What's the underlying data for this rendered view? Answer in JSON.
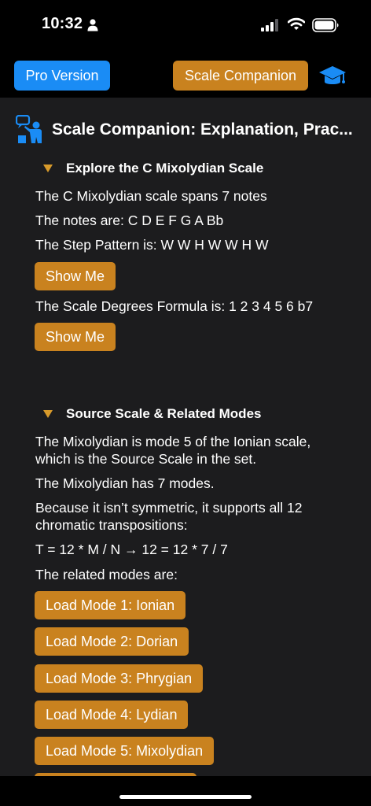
{
  "status": {
    "time": "10:32"
  },
  "toolbar": {
    "pro_label": "Pro Version",
    "companion_label": "Scale Companion"
  },
  "header": {
    "title": "Scale Companion: Explanation, Prac..."
  },
  "explore": {
    "title": "Explore the C Mixolydian Scale",
    "spans": "The C Mixolydian scale spans 7 notes",
    "notes": "The notes are:  C D E F G A Bb",
    "steps": "The Step Pattern is: W W H W W H W",
    "show_me_1": "Show Me",
    "degrees": "The Scale Degrees Formula is: 1 2 3 4 5 6 b7",
    "show_me_2": "Show Me"
  },
  "source": {
    "title": "Source Scale & Related Modes",
    "line1a": "The Mixolydian is mode 5 of the Ionian scale,",
    "line1b": "which is the Source Scale in the set.",
    "line2": "The Mixolydian has 7 modes.",
    "line3a": "Because it isn’t symmetric, it supports all 12",
    "line3b": "chromatic transpositions:",
    "formula": "T = 12 * M / N → 12 = 12 * 7 / 7",
    "related": " The related modes are:",
    "modes": [
      "Load Mode 1: Ionian",
      "Load Mode 2: Dorian",
      "Load Mode 3: Phrygian",
      "Load Mode 4: Lydian",
      "Load Mode 5: Mixolydian"
    ]
  },
  "colors": {
    "accent_orange": "#c9821f",
    "accent_blue": "#1a8cf5",
    "panel_bg": "#1c1c1e"
  }
}
